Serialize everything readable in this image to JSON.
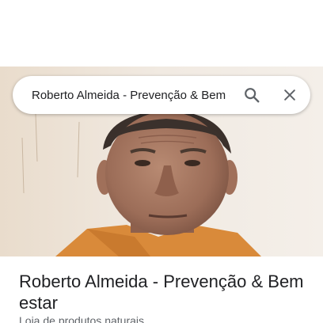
{
  "search": {
    "query": "Roberto Almeida - Prevenção & Bem estar",
    "search_icon": "search-icon",
    "close_icon": "close-icon"
  },
  "place": {
    "title": "Roberto Almeida - Prevenção & Bem estar",
    "category": "Loja de produtos naturais"
  }
}
